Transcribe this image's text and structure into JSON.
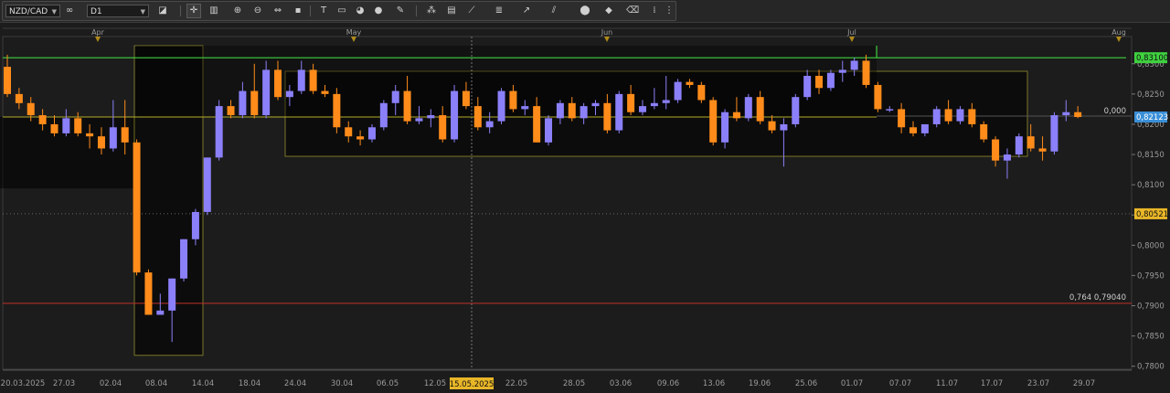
{
  "toolbar": {
    "symbol": "NZD/CAD",
    "timeframe": "D1",
    "symbol_icon": "infinity-icon",
    "colors": {
      "background": "#262626",
      "button": "#cfcfcf"
    }
  },
  "chart_data": {
    "type": "candlestick",
    "symbol": "NZD/CAD",
    "timeframe": "D1",
    "ylim": [
      0.7795,
      0.8345
    ],
    "y_ticks": [
      "0,8300",
      "0,8250",
      "0,8200",
      "0,8150",
      "0,8100",
      "0,8050",
      "0,8000",
      "0,7950",
      "0,7900",
      "0,7850",
      "0,7800"
    ],
    "x_tick_labels": [
      "20.03.2025",
      "27.03",
      "02.04",
      "08.04",
      "14.04",
      "18.04",
      "24.04",
      "30.04",
      "06.05",
      "12.05",
      "22.05",
      "28.05",
      "03.06",
      "09.06",
      "13.06",
      "19.06",
      "25.06",
      "01.07",
      "07.07",
      "11.07",
      "17.07",
      "23.07",
      "29.07"
    ],
    "month_labels": [
      "Apr",
      "May",
      "Jun",
      "Jul",
      "Aug"
    ],
    "crosshair_date": "15.05.2025",
    "price_labels": {
      "current": "0,82123",
      "green_line": "0,83100",
      "yellow_line": "0,80521",
      "yellow_level_text": "0,000",
      "red_line_text": "0,764 0,79040"
    },
    "levels": {
      "green": 0.831,
      "yellow": 0.8212,
      "red": 0.7904,
      "dotted": 0.8052
    },
    "candle_colors": {
      "up": "#8b80f9",
      "down": "#ff8c1a"
    },
    "candles": [
      {
        "o": 0.8295,
        "h": 0.8315,
        "l": 0.8245,
        "c": 0.825
      },
      {
        "o": 0.825,
        "h": 0.826,
        "l": 0.8225,
        "c": 0.8235
      },
      {
        "o": 0.8235,
        "h": 0.8245,
        "l": 0.8205,
        "c": 0.8215
      },
      {
        "o": 0.8215,
        "h": 0.8225,
        "l": 0.819,
        "c": 0.82
      },
      {
        "o": 0.82,
        "h": 0.8215,
        "l": 0.818,
        "c": 0.8185
      },
      {
        "o": 0.8185,
        "h": 0.8225,
        "l": 0.818,
        "c": 0.821
      },
      {
        "o": 0.821,
        "h": 0.822,
        "l": 0.818,
        "c": 0.8185
      },
      {
        "o": 0.8185,
        "h": 0.82,
        "l": 0.816,
        "c": 0.818
      },
      {
        "o": 0.818,
        "h": 0.8195,
        "l": 0.815,
        "c": 0.816
      },
      {
        "o": 0.816,
        "h": 0.824,
        "l": 0.8155,
        "c": 0.8195
      },
      {
        "o": 0.8195,
        "h": 0.824,
        "l": 0.815,
        "c": 0.817
      },
      {
        "o": 0.817,
        "h": 0.8175,
        "l": 0.795,
        "c": 0.7955
      },
      {
        "o": 0.7955,
        "h": 0.796,
        "l": 0.7885,
        "c": 0.7885
      },
      {
        "o": 0.7885,
        "h": 0.792,
        "l": 0.7885,
        "c": 0.7892
      },
      {
        "o": 0.7892,
        "h": 0.7945,
        "l": 0.784,
        "c": 0.7945
      },
      {
        "o": 0.7945,
        "h": 0.801,
        "l": 0.794,
        "c": 0.801
      },
      {
        "o": 0.801,
        "h": 0.806,
        "l": 0.8,
        "c": 0.8055
      },
      {
        "o": 0.8055,
        "h": 0.8145,
        "l": 0.805,
        "c": 0.8145
      },
      {
        "o": 0.8145,
        "h": 0.824,
        "l": 0.814,
        "c": 0.823
      },
      {
        "o": 0.823,
        "h": 0.824,
        "l": 0.821,
        "c": 0.8215
      },
      {
        "o": 0.8215,
        "h": 0.827,
        "l": 0.821,
        "c": 0.8255
      },
      {
        "o": 0.8255,
        "h": 0.83,
        "l": 0.821,
        "c": 0.8215
      },
      {
        "o": 0.8215,
        "h": 0.8305,
        "l": 0.821,
        "c": 0.829
      },
      {
        "o": 0.829,
        "h": 0.8305,
        "l": 0.824,
        "c": 0.8245
      },
      {
        "o": 0.8245,
        "h": 0.8265,
        "l": 0.823,
        "c": 0.8255
      },
      {
        "o": 0.8255,
        "h": 0.8305,
        "l": 0.825,
        "c": 0.829
      },
      {
        "o": 0.829,
        "h": 0.83,
        "l": 0.825,
        "c": 0.8255
      },
      {
        "o": 0.8255,
        "h": 0.8265,
        "l": 0.8245,
        "c": 0.825
      },
      {
        "o": 0.825,
        "h": 0.826,
        "l": 0.8185,
        "c": 0.8195
      },
      {
        "o": 0.8195,
        "h": 0.8205,
        "l": 0.817,
        "c": 0.818
      },
      {
        "o": 0.818,
        "h": 0.819,
        "l": 0.8165,
        "c": 0.8175
      },
      {
        "o": 0.8175,
        "h": 0.82,
        "l": 0.817,
        "c": 0.8195
      },
      {
        "o": 0.8195,
        "h": 0.824,
        "l": 0.819,
        "c": 0.8235
      },
      {
        "o": 0.8235,
        "h": 0.8265,
        "l": 0.8215,
        "c": 0.8255
      },
      {
        "o": 0.8255,
        "h": 0.828,
        "l": 0.82,
        "c": 0.8205
      },
      {
        "o": 0.8205,
        "h": 0.823,
        "l": 0.82,
        "c": 0.821
      },
      {
        "o": 0.821,
        "h": 0.8225,
        "l": 0.8195,
        "c": 0.8215
      },
      {
        "o": 0.8215,
        "h": 0.823,
        "l": 0.817,
        "c": 0.8175
      },
      {
        "o": 0.8175,
        "h": 0.8265,
        "l": 0.817,
        "c": 0.8255
      },
      {
        "o": 0.8255,
        "h": 0.827,
        "l": 0.8225,
        "c": 0.823
      },
      {
        "o": 0.823,
        "h": 0.8245,
        "l": 0.819,
        "c": 0.8195
      },
      {
        "o": 0.8195,
        "h": 0.822,
        "l": 0.8185,
        "c": 0.8205
      },
      {
        "o": 0.8205,
        "h": 0.826,
        "l": 0.82,
        "c": 0.8255
      },
      {
        "o": 0.8255,
        "h": 0.8265,
        "l": 0.822,
        "c": 0.8225
      },
      {
        "o": 0.8225,
        "h": 0.824,
        "l": 0.8215,
        "c": 0.823
      },
      {
        "o": 0.823,
        "h": 0.8245,
        "l": 0.817,
        "c": 0.817
      },
      {
        "o": 0.817,
        "h": 0.8215,
        "l": 0.8165,
        "c": 0.821
      },
      {
        "o": 0.821,
        "h": 0.824,
        "l": 0.82,
        "c": 0.8235
      },
      {
        "o": 0.8235,
        "h": 0.8245,
        "l": 0.8205,
        "c": 0.821
      },
      {
        "o": 0.821,
        "h": 0.8235,
        "l": 0.82,
        "c": 0.823
      },
      {
        "o": 0.823,
        "h": 0.824,
        "l": 0.8215,
        "c": 0.8235
      },
      {
        "o": 0.8235,
        "h": 0.825,
        "l": 0.8185,
        "c": 0.819
      },
      {
        "o": 0.819,
        "h": 0.8255,
        "l": 0.8185,
        "c": 0.825
      },
      {
        "o": 0.825,
        "h": 0.8265,
        "l": 0.8215,
        "c": 0.822
      },
      {
        "o": 0.822,
        "h": 0.824,
        "l": 0.8215,
        "c": 0.823
      },
      {
        "o": 0.823,
        "h": 0.826,
        "l": 0.8225,
        "c": 0.8235
      },
      {
        "o": 0.8235,
        "h": 0.828,
        "l": 0.8225,
        "c": 0.824
      },
      {
        "o": 0.824,
        "h": 0.8275,
        "l": 0.8235,
        "c": 0.827
      },
      {
        "o": 0.827,
        "h": 0.8275,
        "l": 0.826,
        "c": 0.8265
      },
      {
        "o": 0.8265,
        "h": 0.827,
        "l": 0.8235,
        "c": 0.824
      },
      {
        "o": 0.824,
        "h": 0.8245,
        "l": 0.8165,
        "c": 0.817
      },
      {
        "o": 0.817,
        "h": 0.8225,
        "l": 0.816,
        "c": 0.822
      },
      {
        "o": 0.822,
        "h": 0.8245,
        "l": 0.8205,
        "c": 0.821
      },
      {
        "o": 0.821,
        "h": 0.825,
        "l": 0.8205,
        "c": 0.8245
      },
      {
        "o": 0.8245,
        "h": 0.8255,
        "l": 0.82,
        "c": 0.8205
      },
      {
        "o": 0.8205,
        "h": 0.8215,
        "l": 0.8185,
        "c": 0.819
      },
      {
        "o": 0.819,
        "h": 0.821,
        "l": 0.813,
        "c": 0.82
      },
      {
        "o": 0.82,
        "h": 0.825,
        "l": 0.8195,
        "c": 0.8245
      },
      {
        "o": 0.8245,
        "h": 0.829,
        "l": 0.824,
        "c": 0.828
      },
      {
        "o": 0.828,
        "h": 0.829,
        "l": 0.825,
        "c": 0.826
      },
      {
        "o": 0.826,
        "h": 0.829,
        "l": 0.8255,
        "c": 0.8285
      },
      {
        "o": 0.8285,
        "h": 0.8305,
        "l": 0.827,
        "c": 0.829
      },
      {
        "o": 0.829,
        "h": 0.831,
        "l": 0.828,
        "c": 0.8305
      },
      {
        "o": 0.8305,
        "h": 0.8315,
        "l": 0.826,
        "c": 0.8265
      },
      {
        "o": 0.8265,
        "h": 0.827,
        "l": 0.822,
        "c": 0.8225
      },
      {
        "o": 0.8225,
        "h": 0.823,
        "l": 0.822,
        "c": 0.8225
      },
      {
        "o": 0.8225,
        "h": 0.8235,
        "l": 0.8185,
        "c": 0.8195
      },
      {
        "o": 0.8195,
        "h": 0.8205,
        "l": 0.818,
        "c": 0.8185
      },
      {
        "o": 0.8185,
        "h": 0.82,
        "l": 0.818,
        "c": 0.82
      },
      {
        "o": 0.82,
        "h": 0.823,
        "l": 0.8195,
        "c": 0.8225
      },
      {
        "o": 0.8225,
        "h": 0.824,
        "l": 0.82,
        "c": 0.8205
      },
      {
        "o": 0.8205,
        "h": 0.823,
        "l": 0.82,
        "c": 0.8225
      },
      {
        "o": 0.8225,
        "h": 0.8235,
        "l": 0.8195,
        "c": 0.82
      },
      {
        "o": 0.82,
        "h": 0.8205,
        "l": 0.817,
        "c": 0.8175
      },
      {
        "o": 0.8175,
        "h": 0.818,
        "l": 0.813,
        "c": 0.814
      },
      {
        "o": 0.814,
        "h": 0.816,
        "l": 0.811,
        "c": 0.815
      },
      {
        "o": 0.815,
        "h": 0.8185,
        "l": 0.8145,
        "c": 0.818
      },
      {
        "o": 0.818,
        "h": 0.82,
        "l": 0.8155,
        "c": 0.816
      },
      {
        "o": 0.816,
        "h": 0.818,
        "l": 0.814,
        "c": 0.8155
      },
      {
        "o": 0.8155,
        "h": 0.822,
        "l": 0.815,
        "c": 0.8215
      },
      {
        "o": 0.8215,
        "h": 0.824,
        "l": 0.8205,
        "c": 0.822
      },
      {
        "o": 0.822,
        "h": 0.823,
        "l": 0.821,
        "c": 0.8212
      }
    ]
  }
}
